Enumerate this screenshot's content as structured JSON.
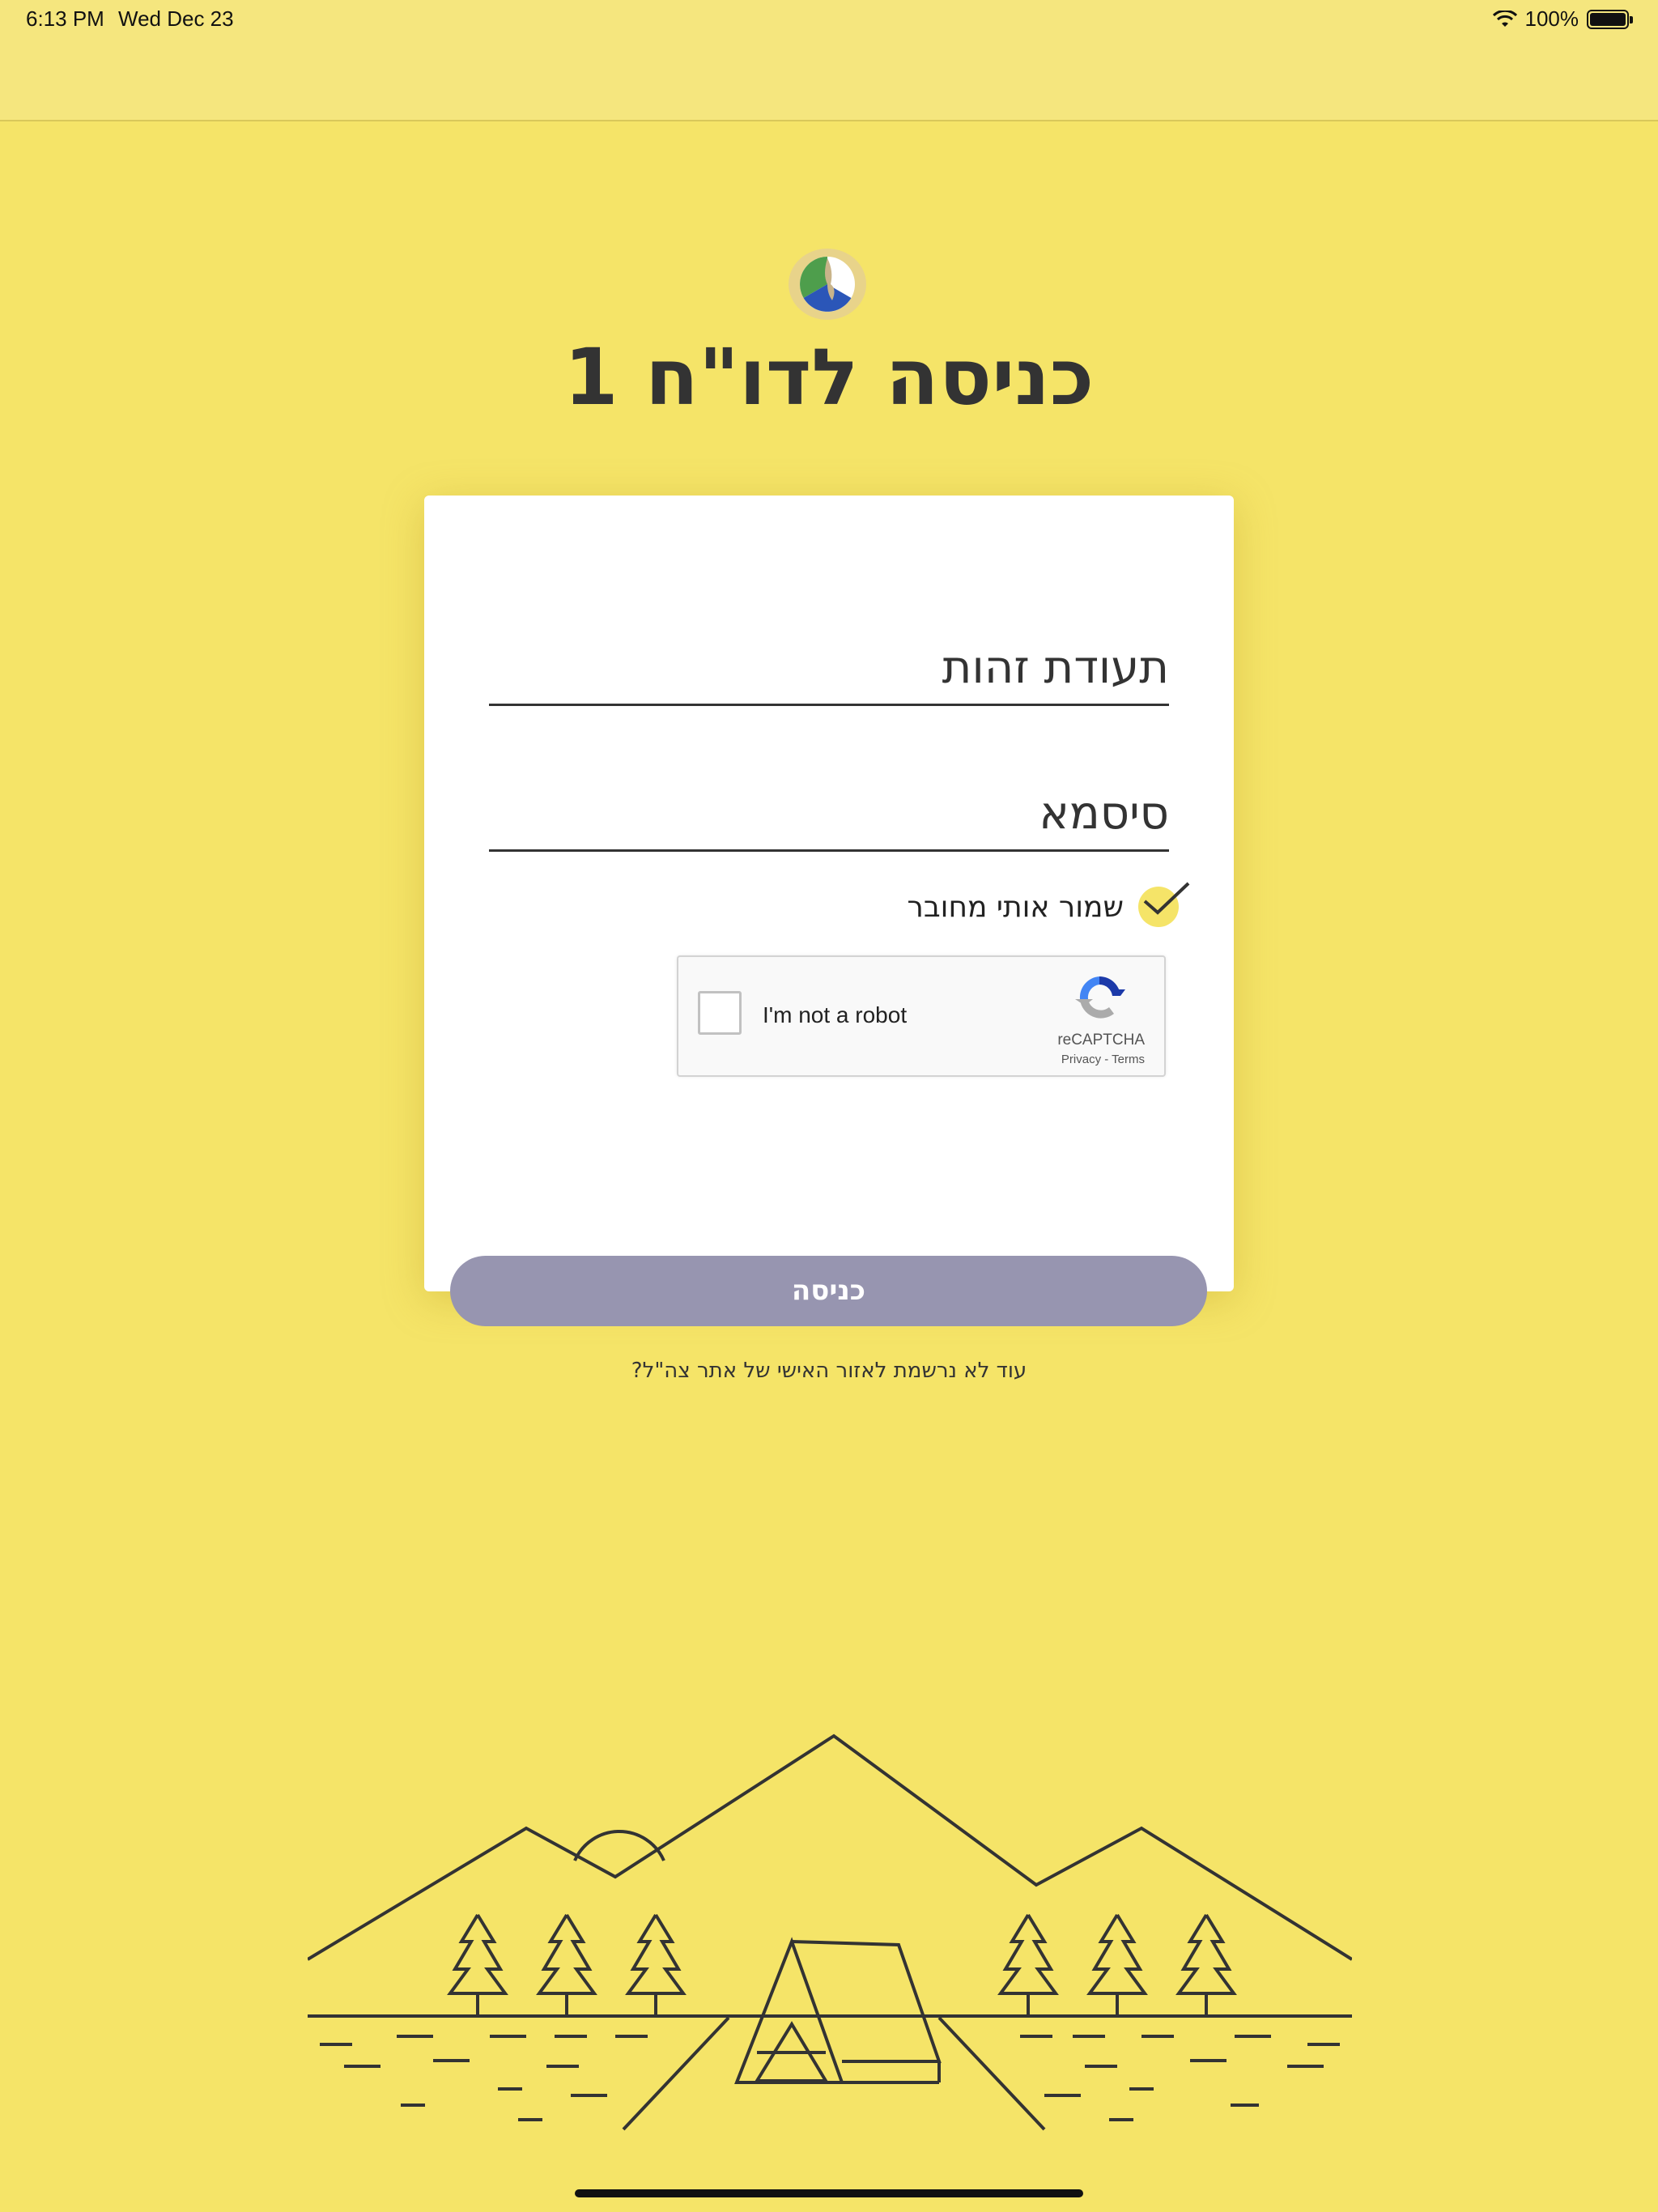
{
  "status_bar": {
    "time": "6:13 PM",
    "date": "Wed Dec 23",
    "battery": "100%"
  },
  "page": {
    "title": "כניסה לדו\"ח 1",
    "background_color": "#f5e468"
  },
  "form": {
    "id_placeholder": "תעודת זהות",
    "password_placeholder": "סיסמא",
    "remember_me_label": "שמור אותי מחובר",
    "remember_me_checked": true,
    "submit_label": "כניסה",
    "submit_color": "#9795b0"
  },
  "recaptcha": {
    "label": "I'm not a robot",
    "brand": "reCAPTCHA",
    "links": "Privacy - Terms"
  },
  "register_link": "עוד לא נרשמת לאזור האישי של אתר צה\"ל?"
}
